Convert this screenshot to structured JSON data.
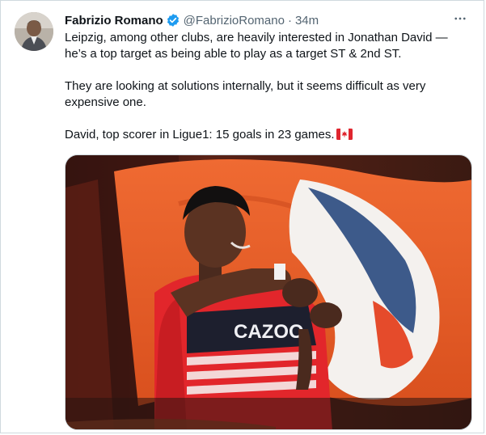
{
  "author": {
    "name": "Fabrizio Romano",
    "handle": "@FabrizioRomano",
    "separator": "·",
    "time": "34m",
    "avatar_icon": "profile-photo",
    "verified_icon": "verified-badge-icon"
  },
  "more_icon_label": "···",
  "body": {
    "p1": "Leipzig, among other clubs, are heavily interested in Jonathan David — he’s a top target as being able to play as a target ST & 2nd ST.",
    "p2": "They are looking at solutions internally, but it seems difficult as very expensive one.",
    "p3": "David, top scorer in Ligue1: 15 goals in 23 games.",
    "flag_icon": "canada-flag-icon"
  },
  "media": {
    "shirt_sponsor": "CAZOO"
  },
  "colors": {
    "verified": "#1d9bf0",
    "muted": "#536471",
    "flag_orange": "#e8602a",
    "shirt_red": "#e2262b"
  }
}
